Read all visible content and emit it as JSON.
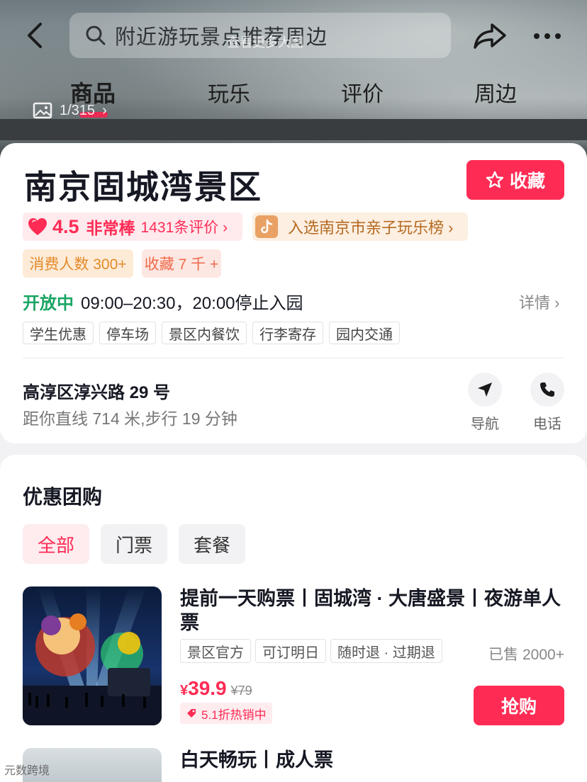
{
  "header": {
    "search_placeholder": "附近游玩景点推荐周边",
    "photo_hint": "查看更多大图",
    "photo_count": "1/315",
    "tabs": [
      {
        "label": "商品",
        "active": true
      },
      {
        "label": "玩乐",
        "active": false
      },
      {
        "label": "评价",
        "active": false
      },
      {
        "label": "周边",
        "active": false
      }
    ],
    "icons": [
      "back-arrow-icon",
      "search-icon",
      "share-icon",
      "more-icon",
      "image-icon"
    ]
  },
  "info": {
    "title": "南京固城湾景区",
    "favorite_label": "收藏",
    "rating": {
      "score": "4.5",
      "word": "非常棒",
      "count": "1431条评价 ›"
    },
    "rank_label": "入选南京市亲子玩乐榜 ›",
    "consume_badge": "消费人数 300+",
    "fav_badge": "收藏 7 千 +",
    "status": "开放中",
    "hours": "09:00–20:30，20:00停止入园",
    "details_label": "详情 ›",
    "facilities": [
      "学生优惠",
      "停车场",
      "景区内餐饮",
      "行李寄存",
      "园内交通"
    ],
    "address": "高淳区淳兴路 29 号",
    "distance": "距你直线 714 米,步行 19 分钟",
    "actions": [
      {
        "label": "导航",
        "icon": "navigation-icon"
      },
      {
        "label": "电话",
        "icon": "phone-icon"
      }
    ]
  },
  "deals": {
    "title": "优惠团购",
    "filters": [
      {
        "label": "全部",
        "active": true
      },
      {
        "label": "门票",
        "active": false
      },
      {
        "label": "套餐",
        "active": false
      }
    ],
    "items": [
      {
        "title": "提前一天购票丨固城湾 · 大唐盛景丨夜游单人票",
        "tags": [
          "景区官方",
          "可订明日",
          "随时退 · 过期退"
        ],
        "sold": "已售 2000+",
        "currency": "¥",
        "price": "39.9",
        "original_price": "¥79",
        "promo": "5.1折热销中",
        "buy_label": "抢购"
      },
      {
        "title": "白天畅玩丨成人票"
      }
    ]
  },
  "watermark": "元数跨境",
  "colors": {
    "accent": "#fe2c55",
    "open": "#1aa564",
    "rank": "#b56a22",
    "consume": "#e58a2a"
  }
}
